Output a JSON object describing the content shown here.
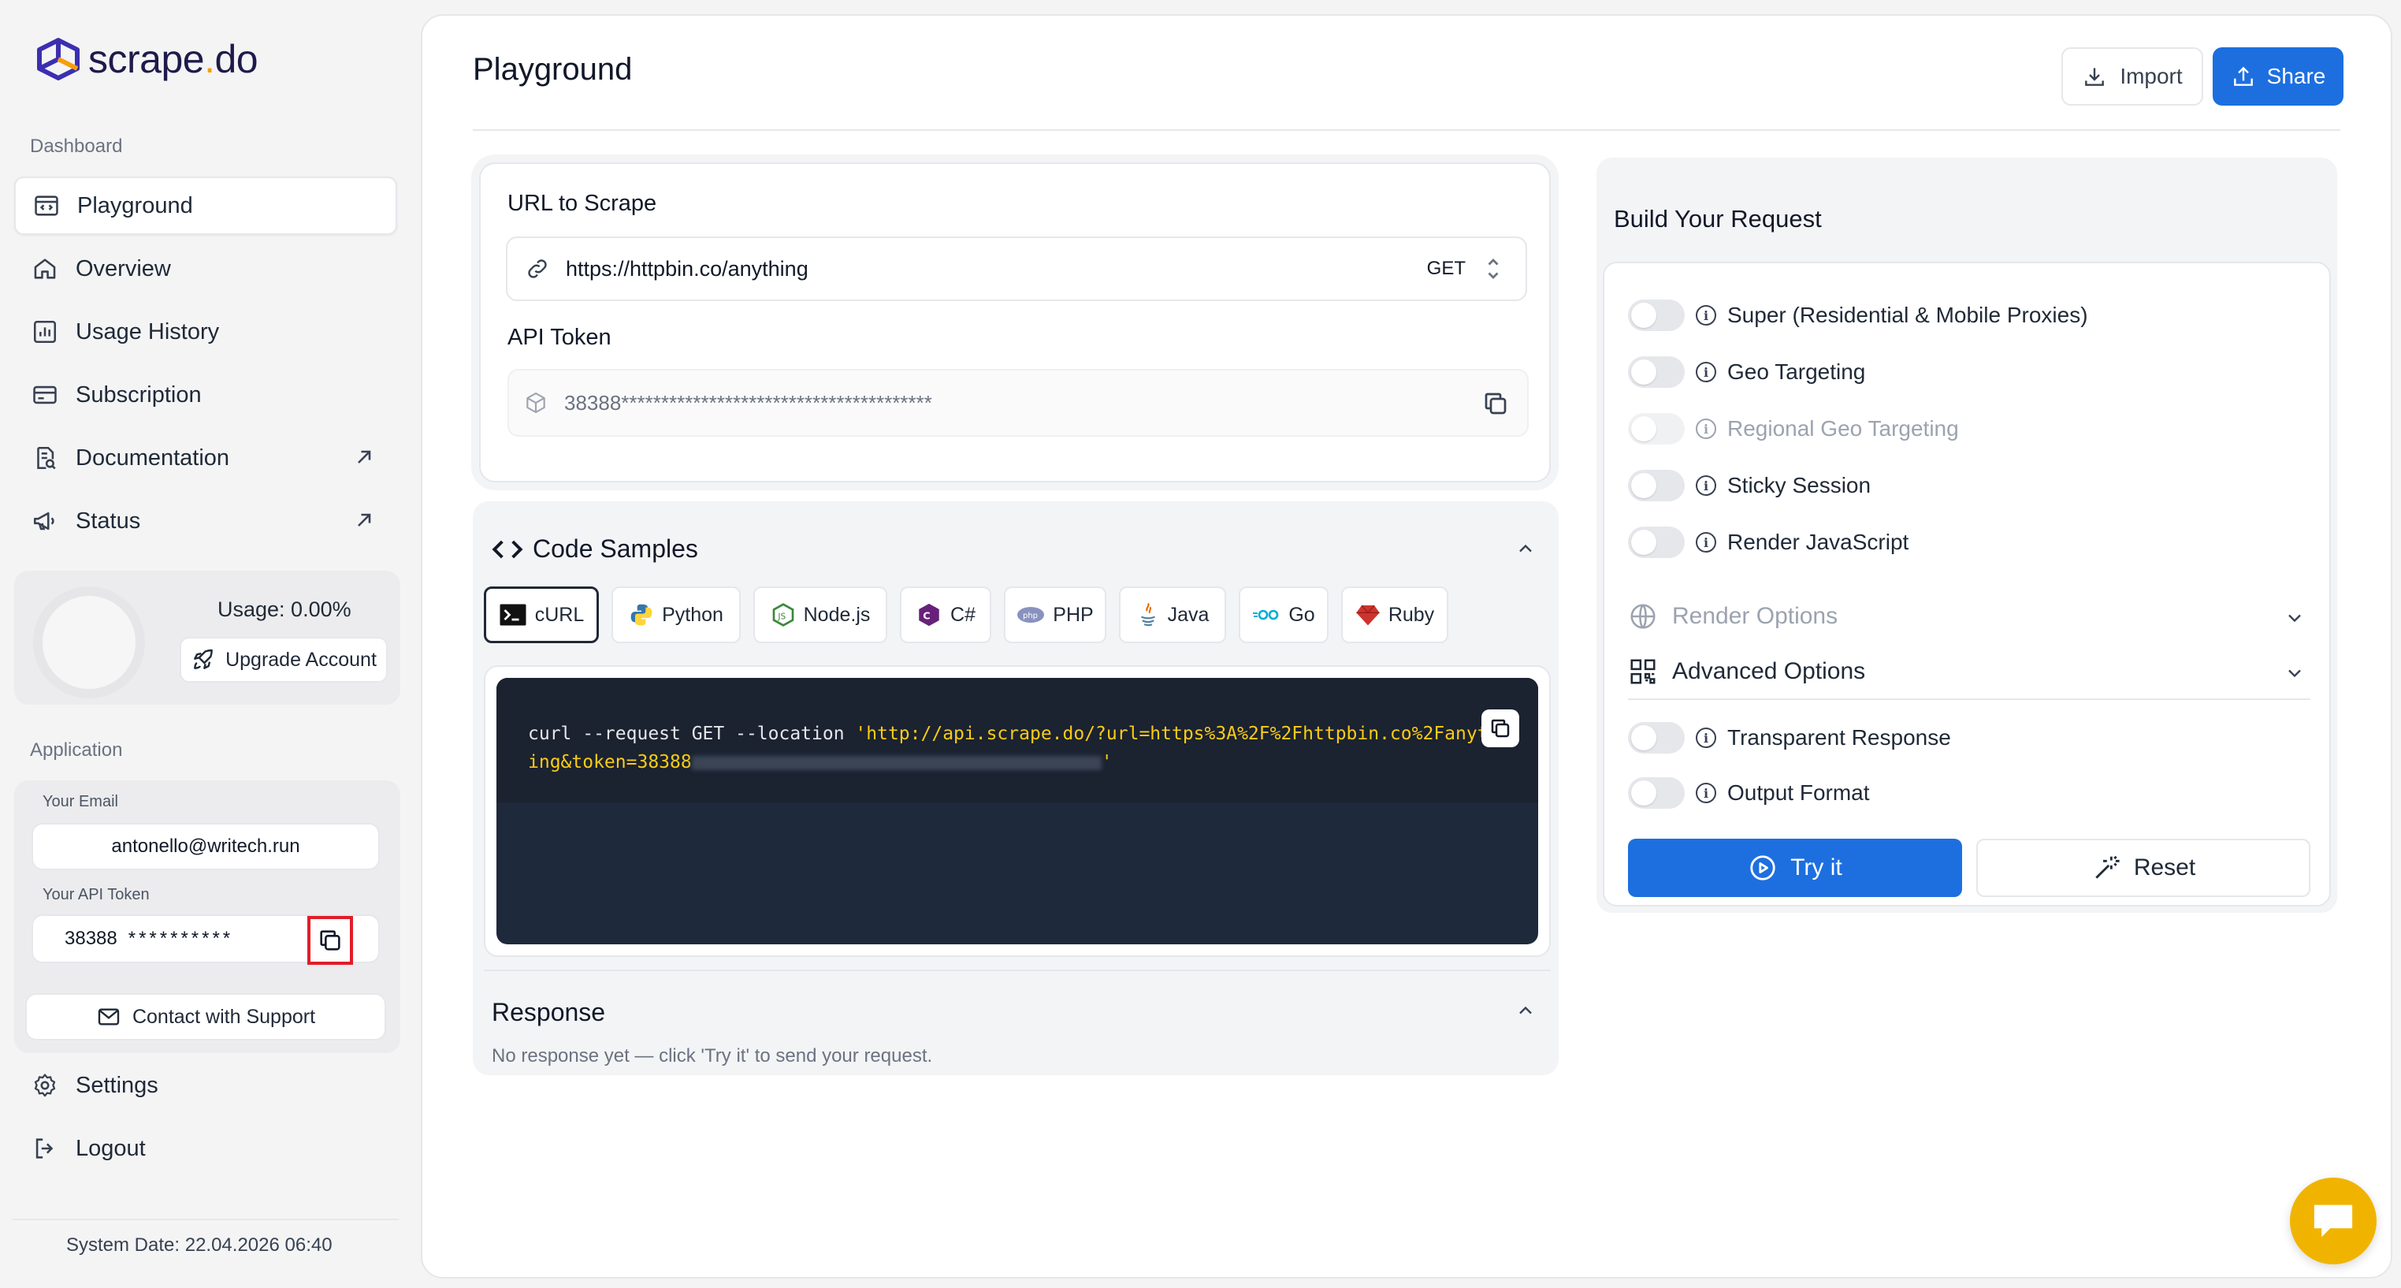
{
  "brand": {
    "name": "scrape",
    "dot": ".",
    "suffix": "do"
  },
  "sidebar": {
    "section_dashboard": "Dashboard",
    "items": [
      {
        "label": "Playground",
        "icon": "code-window-icon",
        "active": true
      },
      {
        "label": "Overview",
        "icon": "home-icon"
      },
      {
        "label": "Usage History",
        "icon": "bar-chart-icon"
      },
      {
        "label": "Subscription",
        "icon": "credit-card-icon"
      },
      {
        "label": "Documentation",
        "icon": "document-search-icon",
        "external": true
      },
      {
        "label": "Status",
        "icon": "megaphone-icon",
        "external": true
      }
    ],
    "usage": {
      "text": "Usage: 0.00%",
      "value_percent": 0,
      "upgrade_label": "Upgrade Account"
    },
    "section_application": "Application",
    "email_label": "Your Email",
    "email_value": "antonello@writech.run",
    "token_label": "Your API Token",
    "token_prefix": "38388",
    "token_masked": "**********",
    "support_label": "Contact with Support",
    "settings_label": "Settings",
    "logout_label": "Logout",
    "system_date": "System Date: 22.04.2026 06:40"
  },
  "header": {
    "title": "Playground",
    "import_label": "Import",
    "share_label": "Share"
  },
  "request": {
    "url_label": "URL to Scrape",
    "url_value": "https://httpbin.co/anything",
    "method": "GET",
    "token_label": "API Token",
    "token_value": "38388***************************************"
  },
  "code_samples": {
    "title": "Code Samples",
    "tabs": [
      {
        "label": "cURL",
        "icon": "terminal-icon",
        "active": true
      },
      {
        "label": "Python",
        "icon": "python-icon"
      },
      {
        "label": "Node.js",
        "icon": "nodejs-icon"
      },
      {
        "label": "C#",
        "icon": "csharp-icon"
      },
      {
        "label": "PHP",
        "icon": "php-icon"
      },
      {
        "label": "Java",
        "icon": "java-icon"
      },
      {
        "label": "Go",
        "icon": "go-icon"
      },
      {
        "label": "Ruby",
        "icon": "ruby-icon"
      }
    ],
    "code_cmd": "curl --request GET --location ",
    "code_str_1": "'http://api.scrape.do/?url=https%3A%2F%2Fhttpbin.co%2Fanyth",
    "code_str_2a": "ing&token=38388",
    "code_str_2b": "'"
  },
  "response": {
    "title": "Response",
    "empty_text": "No response yet — click 'Try it' to send your request."
  },
  "build": {
    "title": "Build Your Request",
    "options": [
      {
        "label": "Super (Residential & Mobile Proxies)",
        "enabled": false,
        "disabled": false
      },
      {
        "label": "Geo Targeting",
        "enabled": false,
        "disabled": false
      },
      {
        "label": "Regional Geo Targeting",
        "enabled": false,
        "disabled": true
      },
      {
        "label": "Sticky Session",
        "enabled": false,
        "disabled": false
      },
      {
        "label": "Render JavaScript",
        "enabled": false,
        "disabled": false
      }
    ],
    "render_options_label": "Render Options",
    "advanced_options_label": "Advanced Options",
    "advanced": [
      {
        "label": "Transparent Response",
        "enabled": false
      },
      {
        "label": "Output Format",
        "enabled": false
      }
    ],
    "try_label": "Try it",
    "reset_label": "Reset"
  },
  "colors": {
    "accent": "#1d6fe0",
    "code_bg": "#1e293b",
    "code_string": "#facc15",
    "highlight_box": "#e11d2a",
    "chat_bubble": "#f0b400"
  }
}
